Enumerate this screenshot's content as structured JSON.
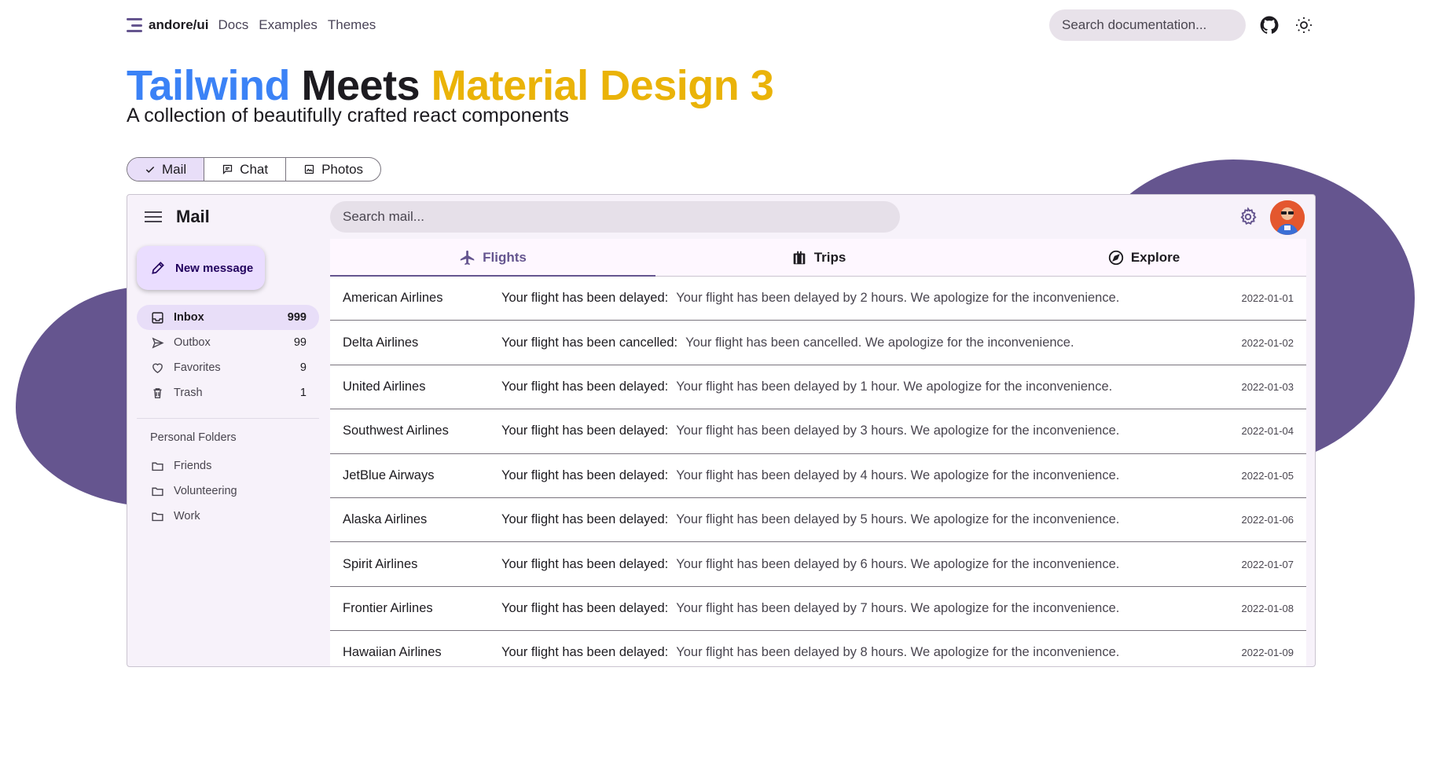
{
  "header": {
    "brand": "andore/ui",
    "nav": [
      "Docs",
      "Examples",
      "Themes"
    ],
    "search_placeholder": "Search documentation..."
  },
  "hero": {
    "title_part1": "Tailwind",
    "title_part2": "Meets",
    "title_part3": "Material Design 3",
    "subtitle": "A collection of beautifully crafted react components"
  },
  "segmented": {
    "options": [
      {
        "label": "Mail",
        "icon": "check-icon"
      },
      {
        "label": "Chat",
        "icon": "chat-icon"
      },
      {
        "label": "Photos",
        "icon": "photo-icon"
      }
    ],
    "selected": "Mail"
  },
  "app": {
    "title": "Mail",
    "search_placeholder": "Search mail...",
    "new_message": "New message",
    "mailboxes": [
      {
        "label": "Inbox",
        "count": "999",
        "icon": "inbox-icon"
      },
      {
        "label": "Outbox",
        "count": "99",
        "icon": "send-icon"
      },
      {
        "label": "Favorites",
        "count": "9",
        "icon": "heart-icon"
      },
      {
        "label": "Trash",
        "count": "1",
        "icon": "trash-icon"
      }
    ],
    "folders_title": "Personal Folders",
    "folders": [
      {
        "label": "Friends",
        "icon": "folder-icon"
      },
      {
        "label": "Volunteering",
        "icon": "folder-icon"
      },
      {
        "label": "Work",
        "icon": "folder-icon"
      }
    ],
    "tabs": [
      {
        "label": "Flights",
        "icon": "airplane-icon"
      },
      {
        "label": "Trips",
        "icon": "luggage-icon"
      },
      {
        "label": "Explore",
        "icon": "compass-icon"
      }
    ],
    "messages": [
      {
        "from": "American Airlines",
        "subject": "Your flight has been delayed:",
        "body": "Your flight has been delayed by 2 hours. We apologize for the inconvenience.",
        "date": "2022-01-01"
      },
      {
        "from": "Delta Airlines",
        "subject": "Your flight has been cancelled:",
        "body": "Your flight has been cancelled. We apologize for the inconvenience.",
        "date": "2022-01-02"
      },
      {
        "from": "United Airlines",
        "subject": "Your flight has been delayed:",
        "body": "Your flight has been delayed by 1 hour. We apologize for the inconvenience.",
        "date": "2022-01-03"
      },
      {
        "from": "Southwest Airlines",
        "subject": "Your flight has been delayed:",
        "body": "Your flight has been delayed by 3 hours. We apologize for the inconvenience.",
        "date": "2022-01-04"
      },
      {
        "from": "JetBlue Airways",
        "subject": "Your flight has been delayed:",
        "body": "Your flight has been delayed by 4 hours. We apologize for the inconvenience.",
        "date": "2022-01-05"
      },
      {
        "from": "Alaska Airlines",
        "subject": "Your flight has been delayed:",
        "body": "Your flight has been delayed by 5 hours. We apologize for the inconvenience.",
        "date": "2022-01-06"
      },
      {
        "from": "Spirit Airlines",
        "subject": "Your flight has been delayed:",
        "body": "Your flight has been delayed by 6 hours. We apologize for the inconvenience.",
        "date": "2022-01-07"
      },
      {
        "from": "Frontier Airlines",
        "subject": "Your flight has been delayed:",
        "body": "Your flight has been delayed by 7 hours. We apologize for the inconvenience.",
        "date": "2022-01-08"
      },
      {
        "from": "Hawaiian Airlines",
        "subject": "Your flight has been delayed:",
        "body": "Your flight has been delayed by 8 hours. We apologize for the inconvenience.",
        "date": "2022-01-09"
      }
    ]
  },
  "colors": {
    "primary": "#65558f",
    "tailwind_blue": "#3b82f6",
    "material_yellow": "#eab308",
    "surface": "#f7f2fa",
    "secondary_container": "#e8def8"
  }
}
